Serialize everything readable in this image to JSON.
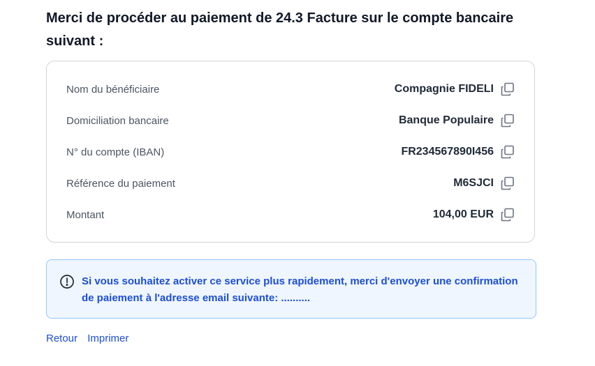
{
  "heading": "Merci de procéder au paiement de 24.3 Facture sur le compte bancaire suivant :",
  "details": [
    {
      "label": "Nom du bénéficiaire",
      "value": "Compagnie FIDELI",
      "icon": "copy-icon"
    },
    {
      "label": "Domiciliation bancaire",
      "value": "Banque Populaire",
      "icon": "copy-icon"
    },
    {
      "label": "N° du compte (IBAN)",
      "value": "FR234567890I456",
      "icon": "copy-icon"
    },
    {
      "label": "Référence du paiement",
      "value": "M6SJCI",
      "icon": "copy-icon"
    },
    {
      "label": "Montant",
      "value": "104,00 EUR",
      "icon": "copy-icon"
    }
  ],
  "notice": {
    "icon": "info-circle-icon",
    "text": "Si vous souhaitez activer ce service plus rapidement, merci d'envoyer une confirmation de paiement à l'adresse email suivante: ..........",
    "colors": {
      "background": "#eff6ff",
      "border": "#93c5fd",
      "text": "#1d4ed8"
    }
  },
  "links": {
    "back_label": "Retour",
    "print_label": "Imprimer"
  },
  "colors": {
    "accent": "#1d4ed8",
    "card_border": "#d1d5db",
    "label": "#4b5563"
  }
}
